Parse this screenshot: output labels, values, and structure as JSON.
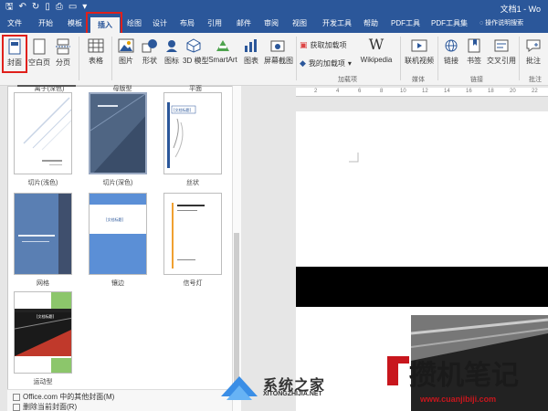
{
  "titlebar": {
    "doc_title": "文档1 - Wo"
  },
  "tabs": [
    "文件",
    "开始",
    "模板",
    "插入",
    "绘图",
    "设计",
    "布局",
    "引用",
    "邮件",
    "审阅",
    "视图",
    "开发工具",
    "帮助",
    "PDF工具",
    "PDF工具集",
    "操作说明搜索"
  ],
  "ribbon": {
    "cover": "封面",
    "blank": "空白页",
    "pagebreak": "分页",
    "table": "表格",
    "pictures": "图片",
    "shapes": "形状",
    "icons": "图标",
    "model3d": "3D 模型",
    "smartart": "SmartArt",
    "chart": "图表",
    "screenshot": "屏幕截图",
    "get_addins": "获取加载项",
    "my_addins": "我的加载项",
    "wikipedia": "Wikipedia",
    "online_video": "联机视频",
    "link": "链接",
    "bookmark": "书签",
    "crossref": "交叉引用",
    "comment": "批注",
    "group_addins": "加载项",
    "group_media": "媒体",
    "group_links": "链接",
    "group_comments": "批注"
  },
  "gallery": {
    "top_row": [
      "离子(深色)",
      "母版型",
      "平面"
    ],
    "row1": [
      "切片(浅色)",
      "切片(深色)",
      "丝状"
    ],
    "row2": [
      "网格",
      "镶边",
      "信号灯"
    ],
    "row3": [
      "运动型"
    ],
    "thumb_title": "[文档标题]"
  },
  "footer": {
    "more": "Office.com 中的其他封面(M)",
    "remove": "删除当前封面(R)"
  },
  "ruler": [
    "2",
    "4",
    "6",
    "8",
    "10",
    "12",
    "14",
    "16",
    "18",
    "20",
    "22"
  ],
  "watermarks": {
    "site1_name": "系统之家",
    "site1_url": "XITONGZHIJIA.NET",
    "site2_name": "攒机笔记",
    "site2_url": "www.cuanjibiji.com"
  },
  "colors": {
    "accent": "#2b579a",
    "highlight": "#e0201b"
  }
}
